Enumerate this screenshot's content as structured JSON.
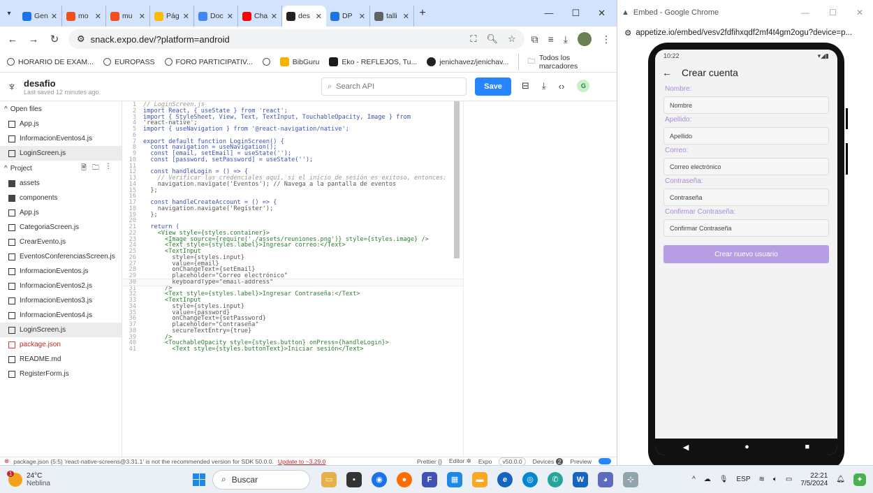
{
  "chrome": {
    "tabs": [
      {
        "label": "Gen",
        "color": "#1a73e8",
        "icon": "gemini-icon"
      },
      {
        "label": "mo",
        "color": "#f24e1e",
        "icon": "figma-icon"
      },
      {
        "label": "mu",
        "color": "#f24e1e",
        "icon": "figma-icon"
      },
      {
        "label": "Pág",
        "color": "#fbbc04",
        "icon": "drive-icon"
      },
      {
        "label": "Doc",
        "color": "#4285f4",
        "icon": "docs-icon"
      },
      {
        "label": "Cha",
        "color": "#ff0000",
        "icon": "youtube-icon"
      },
      {
        "label": "des",
        "color": "#222222",
        "icon": "expo-icon",
        "active": true
      },
      {
        "label": "DP",
        "color": "#1a73e8",
        "icon": "doc-icon"
      },
      {
        "label": "talli",
        "color": "#5f6368",
        "icon": "globe-icon"
      }
    ],
    "url": "snack.expo.dev/?platform=android",
    "bookmarks": [
      "HORARIO DE EXAM...",
      "EUROPASS",
      "FORO PARTICIPATIV...",
      "",
      "BibGuru",
      "Eko - REFLEJOS, Tu...",
      "jenichavez/jenichav..."
    ],
    "all_bookmarks": "Todos los marcadores"
  },
  "snack": {
    "project": "desafio",
    "saved": "Last saved 12 minutes ago.",
    "search_placeholder": "Search API",
    "save_label": "Save",
    "avatar": "G",
    "open_files_label": "Open files",
    "open_files": [
      "App.js",
      "InformacionEventos4.js",
      "LoginScreen.js"
    ],
    "project_label": "Project",
    "project_files": [
      "assets",
      "components",
      "App.js",
      "CategoriaScreen.js",
      "CrearEvento.js",
      "EventosConferenciasScreen.js",
      "InformacionEventos.js",
      "InformacionEventos2.js",
      "InformacionEventos3.js",
      "InformacionEventos4.js",
      "LoginScreen.js",
      "package.json",
      "README.md",
      "RegisterForm.js"
    ],
    "code": [
      "// LoginScreen.js",
      "import React, { useState } from 'react';",
      "import { StyleSheet, View, Text, TextInput, TouchableOpacity, Image } from",
      "'react-native';",
      "import { useNavigation } from '@react-navigation/native';",
      "",
      "export default function LoginScreen() {",
      "  const navigation = useNavigation();",
      "  const [email, setEmail] = useState('');",
      "  const [password, setPassword] = useState('');",
      "",
      "  const handleLogin = () => {",
      "    // Verificar las credenciales aquí, si el inicio de sesión es exitoso, entonces:",
      "    navigation.navigate('Eventos'); // Navega a la pantalla de eventos",
      "  };",
      "",
      "  const handleCreateAccount = () => {",
      "    navigation.navigate('Register');",
      "  };",
      "",
      "  return (",
      "    <View style={styles.container}>",
      "      <Image source={require('./assets/reuniones.png')} style={styles.image} />",
      "      <Text style={styles.label}>Ingresar correo:</Text>",
      "      <TextInput",
      "        style={styles.input}",
      "        value={email}",
      "        onChangeText={setEmail}",
      "        placeholder=\"Correo electrónico\"",
      "        keyboardType=\"email-address\"",
      "      />",
      "      <Text style={styles.label}>Ingresar Contraseña:</Text>",
      "      <TextInput",
      "        style={styles.input}",
      "        value={password}",
      "        onChangeText={setPassword}",
      "        placeholder=\"Contraseña\"",
      "        secureTextEntry={true}",
      "      />",
      "      <TouchableOpacity style={styles.button} onPress={handleLogin}>",
      "        <Text style={styles.buttonText}>Iniciar sesión</Text>"
    ],
    "line_numbers_start": 1,
    "status_error": "package.json (5:5) 'react-native-screens@3.31.1' is not the recommended version for SDK 50.0.0.",
    "status_link": "Update to ~3.29.0",
    "prettier": "Prettier {}",
    "editor": "Editor",
    "expo": "Expo",
    "sdk": "v50.0.0",
    "devices": "Devices",
    "devices_count": "2",
    "preview": "Preview"
  },
  "appetize": {
    "title": "Embed - Google Chrome",
    "url": "appetize.io/embed/vesv2fdfihxqdf2mf4t4gm2ogu?device=p...",
    "time": "10:22",
    "screen_title": "Crear cuenta",
    "fields": [
      {
        "label": "Nombre:",
        "placeholder": "Nombre"
      },
      {
        "label": "Apellido:",
        "placeholder": "Apellido"
      },
      {
        "label": "Correo:",
        "placeholder": "Correo electrónico"
      },
      {
        "label": "Contraseña:",
        "placeholder": "Contraseña"
      },
      {
        "label": "Confirmar Contraseña:",
        "placeholder": "Confirmar Contraseña"
      }
    ],
    "button": "Crear nuevo usuario"
  },
  "taskbar": {
    "temp": "24°C",
    "weather": "Neblina",
    "search": "Buscar",
    "lang": "ESP",
    "time": "22:21",
    "date": "7/5/2024",
    "alert": "1"
  }
}
